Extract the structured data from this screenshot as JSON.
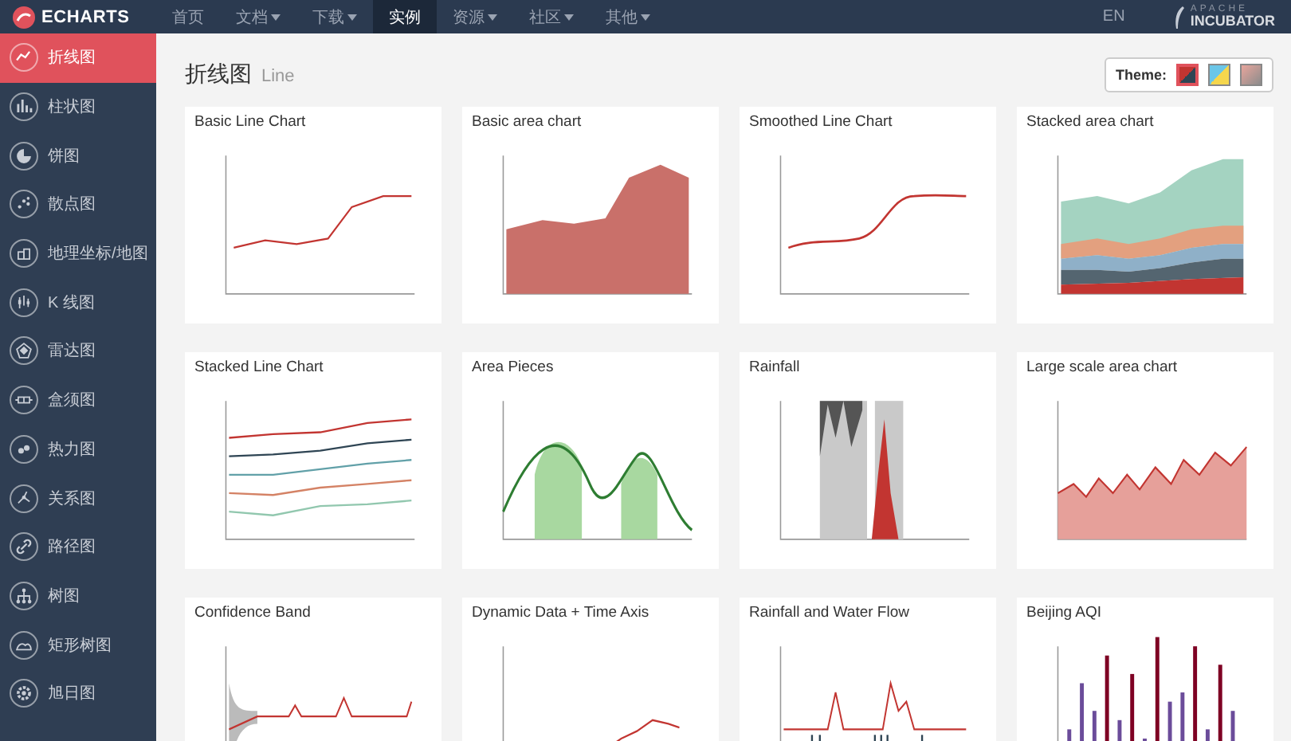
{
  "navbar": {
    "logo": "ECHARTS",
    "items": [
      {
        "label": "首页",
        "dropdown": false,
        "selected": false
      },
      {
        "label": "文档",
        "dropdown": true,
        "selected": false
      },
      {
        "label": "下载",
        "dropdown": true,
        "selected": false
      },
      {
        "label": "实例",
        "dropdown": false,
        "selected": true
      },
      {
        "label": "资源",
        "dropdown": true,
        "selected": false
      },
      {
        "label": "社区",
        "dropdown": true,
        "selected": false
      },
      {
        "label": "其他",
        "dropdown": true,
        "selected": false
      }
    ],
    "language": "EN",
    "incubator": {
      "top": "APACHE",
      "bottom": "INCUBATOR"
    }
  },
  "sidebar": {
    "items": [
      {
        "label": "折线图",
        "selected": true
      },
      {
        "label": "柱状图",
        "selected": false
      },
      {
        "label": "饼图",
        "selected": false
      },
      {
        "label": "散点图",
        "selected": false
      },
      {
        "label": "地理坐标/地图",
        "selected": false
      },
      {
        "label": "K 线图",
        "selected": false
      },
      {
        "label": "雷达图",
        "selected": false
      },
      {
        "label": "盒须图",
        "selected": false
      },
      {
        "label": "热力图",
        "selected": false
      },
      {
        "label": "关系图",
        "selected": false
      },
      {
        "label": "路径图",
        "selected": false
      },
      {
        "label": "树图",
        "selected": false
      },
      {
        "label": "矩形树图",
        "selected": false
      },
      {
        "label": "旭日图",
        "selected": false
      }
    ]
  },
  "heading": {
    "title": "折线图",
    "subtitle": "Line"
  },
  "theme": {
    "label": "Theme:",
    "swatches": [
      {
        "selected": true
      },
      {
        "selected": false
      },
      {
        "selected": false
      }
    ]
  },
  "cards": [
    {
      "title": "Basic Line Chart",
      "kind": "line"
    },
    {
      "title": "Basic area chart",
      "kind": "area"
    },
    {
      "title": "Smoothed Line Chart",
      "kind": "smooth"
    },
    {
      "title": "Stacked area chart",
      "kind": "stacked-area"
    },
    {
      "title": "Stacked Line Chart",
      "kind": "stacked-line"
    },
    {
      "title": "Area Pieces",
      "kind": "pieces"
    },
    {
      "title": "Rainfall",
      "kind": "rainfall"
    },
    {
      "title": "Large scale area chart",
      "kind": "large-area"
    },
    {
      "title": "Confidence Band",
      "kind": "confidence"
    },
    {
      "title": "Dynamic Data + Time Axis",
      "kind": "dynamic"
    },
    {
      "title": "Rainfall and Water Flow",
      "kind": "flow"
    },
    {
      "title": "Beijing AQI",
      "kind": "aqi"
    }
  ]
}
